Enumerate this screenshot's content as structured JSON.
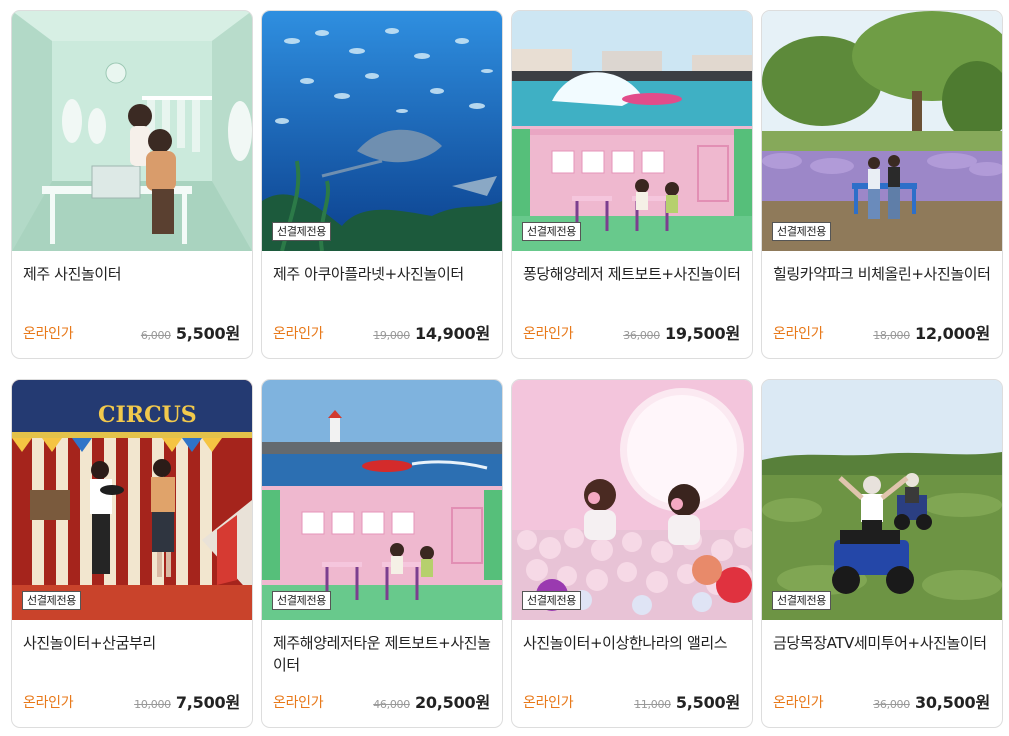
{
  "products": [
    {
      "title": "제주 사진놀이터",
      "badge": "",
      "price_label": "온라인가",
      "original_price": "6,000",
      "sale_price": "5,500원",
      "scene": "studio"
    },
    {
      "title": "제주 아쿠아플라넷+사진놀이터",
      "badge": "선결제전용",
      "price_label": "온라인가",
      "original_price": "19,000",
      "sale_price": "14,900원",
      "scene": "aquarium"
    },
    {
      "title": "퐁당해양레저 제트보트+사진놀이터",
      "badge": "선결제전용",
      "price_label": "온라인가",
      "original_price": "36,000",
      "sale_price": "19,500원",
      "scene": "jetboat-room"
    },
    {
      "title": "힐링카약파크 비체올린+사진놀이터",
      "badge": "선결제전용",
      "price_label": "온라인가",
      "original_price": "18,000",
      "sale_price": "12,000원",
      "scene": "park"
    },
    {
      "title": "사진놀이터+산굼부리",
      "badge": "선결제전용",
      "price_label": "온라인가",
      "original_price": "10,000",
      "sale_price": "7,500원",
      "scene": "circus",
      "sign_text": "CIRCUS"
    },
    {
      "title": "제주해양레저타운 제트보트+사진놀이터",
      "badge": "선결제전용",
      "price_label": "온라인가",
      "original_price": "46,000",
      "sale_price": "20,500원",
      "scene": "jetboat-room"
    },
    {
      "title": "사진놀이터+이상한나라의 앨리스",
      "badge": "선결제전용",
      "price_label": "온라인가",
      "original_price": "11,000",
      "sale_price": "5,500원",
      "scene": "ballpit"
    },
    {
      "title": "금당목장ATV세미투어+사진놀이터",
      "badge": "선결제전용",
      "price_label": "온라인가",
      "original_price": "36,000",
      "sale_price": "30,500원",
      "scene": "atv"
    }
  ],
  "colors": {
    "price_label": "#e8791a",
    "badge_border": "#555555",
    "card_border": "#dddddd"
  }
}
